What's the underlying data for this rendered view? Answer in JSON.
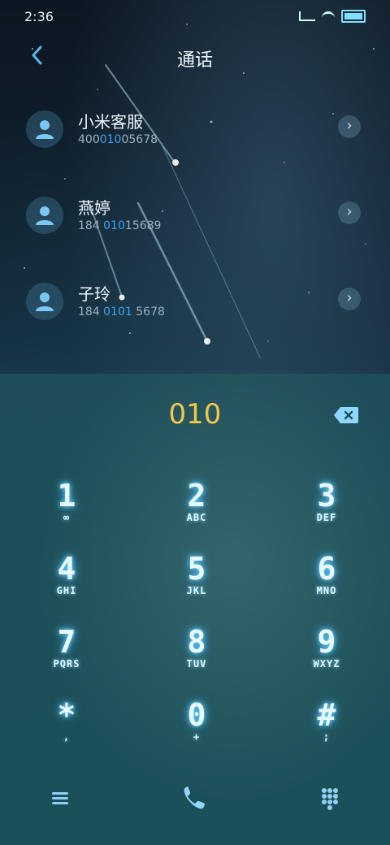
{
  "status": {
    "time": "2:36"
  },
  "header": {
    "back_icon": "chevron-left-icon",
    "title": "通话"
  },
  "contacts": [
    {
      "name": "小米客服",
      "number_pre": "400",
      "number_hl": "010",
      "number_post": "05678"
    },
    {
      "name": "燕婷",
      "number_pre": "184 ",
      "number_hl": "010",
      "number_post": "15689"
    },
    {
      "name": "子玲",
      "number_pre": "184 ",
      "number_hl": "0101",
      "number_post": " 5678"
    }
  ],
  "dialer": {
    "input": "010",
    "keys": [
      {
        "digit": "1",
        "letters": "∞"
      },
      {
        "digit": "2",
        "letters": "ABC"
      },
      {
        "digit": "3",
        "letters": "DEF"
      },
      {
        "digit": "4",
        "letters": "GHI"
      },
      {
        "digit": "5",
        "letters": "JKL"
      },
      {
        "digit": "6",
        "letters": "MNO"
      },
      {
        "digit": "7",
        "letters": "PQRS"
      },
      {
        "digit": "8",
        "letters": "TUV"
      },
      {
        "digit": "9",
        "letters": "WXYZ"
      },
      {
        "digit": "*",
        "letters": ","
      },
      {
        "digit": "0",
        "letters": "+"
      },
      {
        "digit": "#",
        "letters": ";"
      }
    ]
  },
  "colors": {
    "accent": "#3aa4f0",
    "input": "#f2c84b"
  }
}
